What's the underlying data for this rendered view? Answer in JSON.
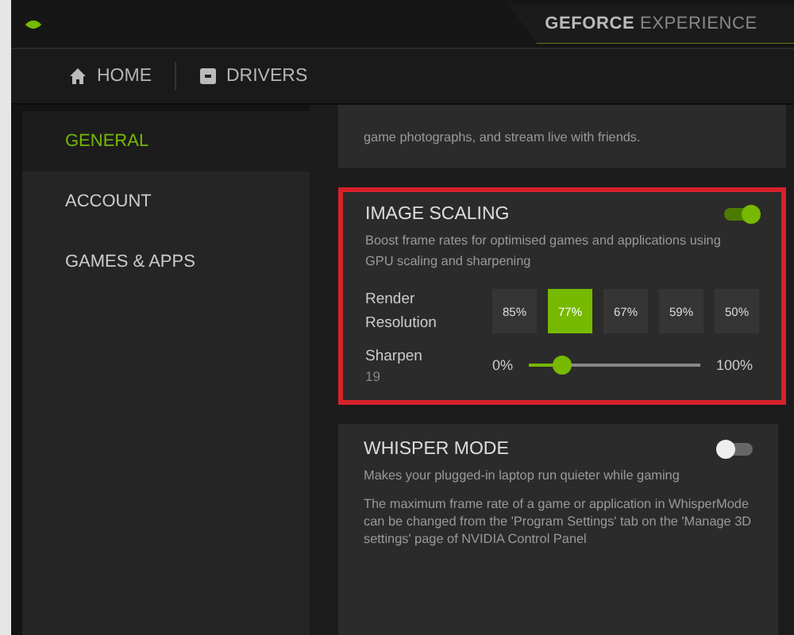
{
  "window": {
    "title": "**GEFORCE** EXPERIENCE"
  },
  "nav": [
    {
      "label": "HOME"
    },
    {
      "label": "DRIVERS"
    }
  ],
  "sidebar": {
    "items": [
      {
        "label": "GENERAL",
        "selected": true
      },
      {
        "label": "ACCOUNT",
        "selected": false
      },
      {
        "label": "GAMES & APPS",
        "selected": false
      }
    ]
  },
  "top_card": {
    "description": "game photographs, and stream live with friends."
  },
  "image_scaling": {
    "title": "IMAGE SCALING",
    "on": true,
    "highlighted": true,
    "description": "Boost frame rates for optimised games and applications using GPU scaling and sharpening",
    "render_label": "Render Resolution",
    "resolutions": [
      {
        "label": "85%",
        "selected": false
      },
      {
        "label": "77%",
        "selected": true
      },
      {
        "label": "67%",
        "selected": false
      },
      {
        "label": "59%",
        "selected": false
      },
      {
        "label": "50%",
        "selected": false
      }
    ],
    "sharpen": {
      "label": "Sharpen",
      "value": "19",
      "min": "0%",
      "max": "100%",
      "level": 0.19
    }
  },
  "whisper_mode": {
    "title": "WHISPER MODE",
    "on": false,
    "description": "Makes your plugged-in laptop run quieter while gaming",
    "note": "The maximum frame rate of a game or application in WhisperMode can be changed from the 'Program Settings' tab on the 'Manage 3D settings' page of NVIDIA Control Panel"
  }
}
